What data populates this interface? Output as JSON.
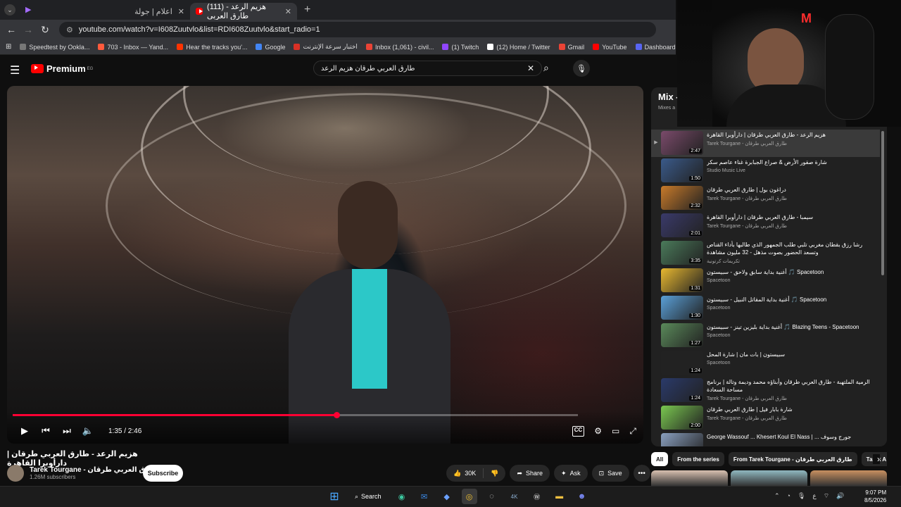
{
  "browser": {
    "tabs": [
      {
        "title": "اعلام | جولة",
        "active": false
      },
      {
        "title": "(111) هزيم الرعد - طارق العربي",
        "active": true
      }
    ],
    "url": "youtube.com/watch?v=I608Zuutvlo&list=RDI608Zuutvlo&start_radio=1",
    "bookmarks": [
      {
        "label": "Speedtest by Ookla...",
        "color": "#777777"
      },
      {
        "label": "703 - Inbox — Yand...",
        "color": "#ff5a3c"
      },
      {
        "label": "Hear the tracks you'...",
        "color": "#ff3300"
      },
      {
        "label": "Google",
        "color": "#4285f4"
      },
      {
        "label": "اختبار سرعة الإنترنت",
        "color": "#d93025"
      },
      {
        "label": "Inbox (1,061) - civil...",
        "color": "#ea4335"
      },
      {
        "label": "(1) Twitch",
        "color": "#9146ff"
      },
      {
        "label": "(12) Home / Twitter",
        "color": "#ffffff"
      },
      {
        "label": "Gmail",
        "color": "#ea4335"
      },
      {
        "label": "YouTube",
        "color": "#ff0000"
      },
      {
        "label": "Dashboard - Restre...",
        "color": "#5865f2"
      }
    ]
  },
  "youtube": {
    "logo_text": "Premium",
    "logo_region": "EG",
    "search_query": "طارق العربي طرقان هزيم الرعد",
    "player": {
      "current_time": "1:35",
      "duration": "2:46",
      "time_display": "1:35 / 2:46",
      "progress": 0.5723,
      "cc_label": "CC"
    },
    "video": {
      "title": "هزيم الرعد - طارق العربي طرقان | دارأوبرا القاهرة",
      "channel": "Tarek Tourgane - طارق العربي طرقان",
      "subscribers": "1.26M subscribers",
      "subscribe_label": "Subscribe",
      "likes": "30K",
      "share_label": "Share",
      "ask_label": "Ask",
      "save_label": "Save"
    },
    "mix": {
      "title": "Mix -",
      "subtitle": "Mixes a",
      "items": [
        {
          "title": "هزيم الرعد - طارق العربي طرقان | دارأوبرا القاهرة",
          "channel": "Tarek Tourgane - طارق العربي طرقان",
          "duration": "2:47",
          "active": true,
          "color": "#7a4a6a"
        },
        {
          "title": "شارة صقور الأرض & صراع الجبابرة غناء عاصم سكر",
          "channel": "Studio Music Live",
          "duration": "1:50",
          "active": false,
          "color": "#3a5a8a"
        },
        {
          "title": "دراغون بول | طارق العربي طرقان",
          "channel": "Tarek Tourgane - طارق العربي طرقان",
          "duration": "2:32",
          "active": false,
          "color": "#c87a2a"
        },
        {
          "title": "سيمبا - طارق العربي طرقان | دارأوبرا القاهرة",
          "channel": "Tarek Tourgane - طارق العربي طرقان",
          "duration": "2:01",
          "active": false,
          "color": "#3a3a6a"
        },
        {
          "title": "رشا رزق بقطان مغربي تلبي طلب الجمهور الذي طالبها بأداء القناص وتسعد الحضور بصوت مذهل - 32 مليون مشاهدة",
          "channel": "تكريمات كرتونية",
          "duration": "3:35",
          "active": false,
          "color": "#4a7a5a"
        },
        {
          "title": "أغنية بداية سابق ولاحق - سبيستون 🎵 Spacetoon",
          "channel": "Spacetoon",
          "duration": "1:31",
          "active": false,
          "color": "#e8b830"
        },
        {
          "title": "أغنية بداية المقاتل النبيل - سبيستون 🎵 Spacetoon",
          "channel": "Spacetoon",
          "duration": "1:30",
          "active": false,
          "color": "#5aa0d8"
        },
        {
          "title": "أغنية بداية بليزين تينز - سبيستون 🎵 Blazing Teens - Spacetoon",
          "channel": "Spacetoon",
          "duration": "1:27",
          "active": false,
          "color": "#5a8a5a"
        },
        {
          "title": "سبيستون | بات مان | شارة المحل",
          "channel": "Spacetoon",
          "duration": "1:24",
          "active": false,
          "color": "#222222"
        },
        {
          "title": "الرمية الملتهبة - طارق العربي طرقان وأبناؤه محمد وديمة وتالة | برنامج مساحة السعادة",
          "channel": "Tarek Tourgane - طارق العربي طرقان",
          "duration": "1:24",
          "active": false,
          "color": "#2a3a6a"
        },
        {
          "title": "شارة بابار فيل | طارق العربي طرقان",
          "channel": "Tarek Tourgane - طارق العربي طرقان",
          "duration": "2:00",
          "active": false,
          "color": "#7ac850"
        },
        {
          "title": "George Wassouf ... Khesert Koul El Nass | ... جورج وسوف",
          "channel": "",
          "duration": "",
          "active": false,
          "color": "#8aa0c0"
        }
      ]
    },
    "chips": [
      "All",
      "From the series",
      "From Tarek Tourgane - طارق العربي طرقان",
      "Tarek A"
    ],
    "rec_colors": [
      "#d8c0b0",
      "#90b8c0",
      "#c89060"
    ]
  },
  "taskbar": {
    "search_label": "Search",
    "time": "9:07 PM",
    "date": "8/5/2026",
    "lang": "ع"
  },
  "overlay": {
    "logo_text": "M"
  }
}
